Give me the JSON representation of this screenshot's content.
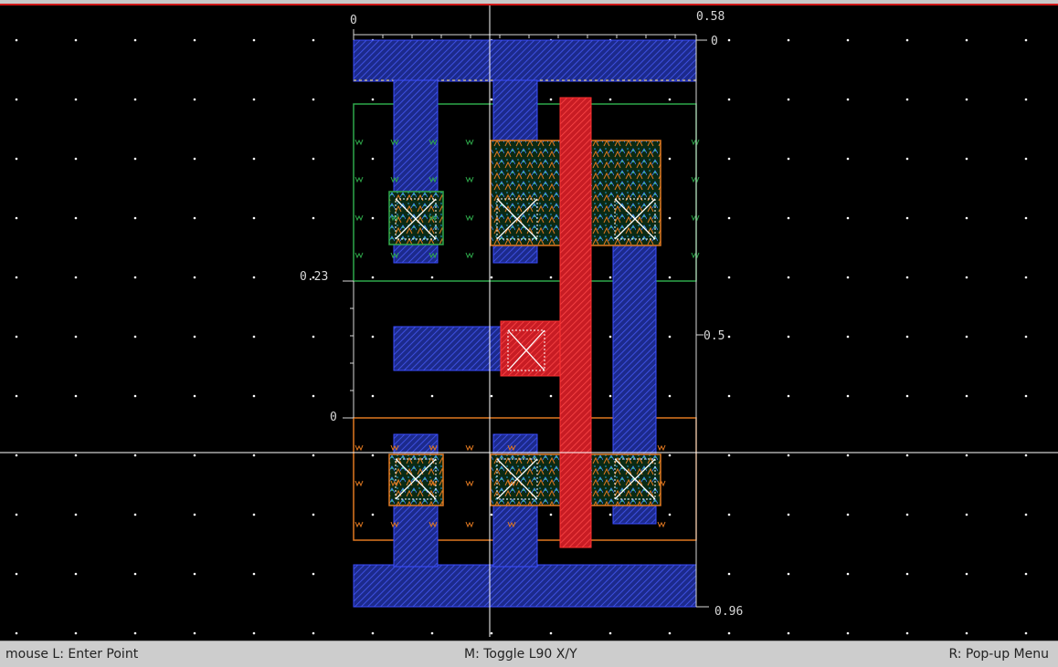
{
  "rulers": {
    "top_left": "0",
    "top_right": "0.58",
    "right_top": "0",
    "left_mid": "0.23",
    "right_mid": "0.5",
    "left_low": "0",
    "bottom_right": "0.96"
  },
  "statusbar": {
    "left": "mouse L: Enter Point",
    "middle": "M: Toggle L90 X/Y",
    "right": "R: Pop-up Menu"
  },
  "colors": {
    "background": "#000000",
    "grid_dot": "#ffffff",
    "metal1": "#2a3cc8",
    "poly": "#e0242c",
    "diffusion": "#20a050",
    "implant_orange": "#e07820",
    "nwell_green": "#2ea84a",
    "crosshair": "#ffffff"
  }
}
